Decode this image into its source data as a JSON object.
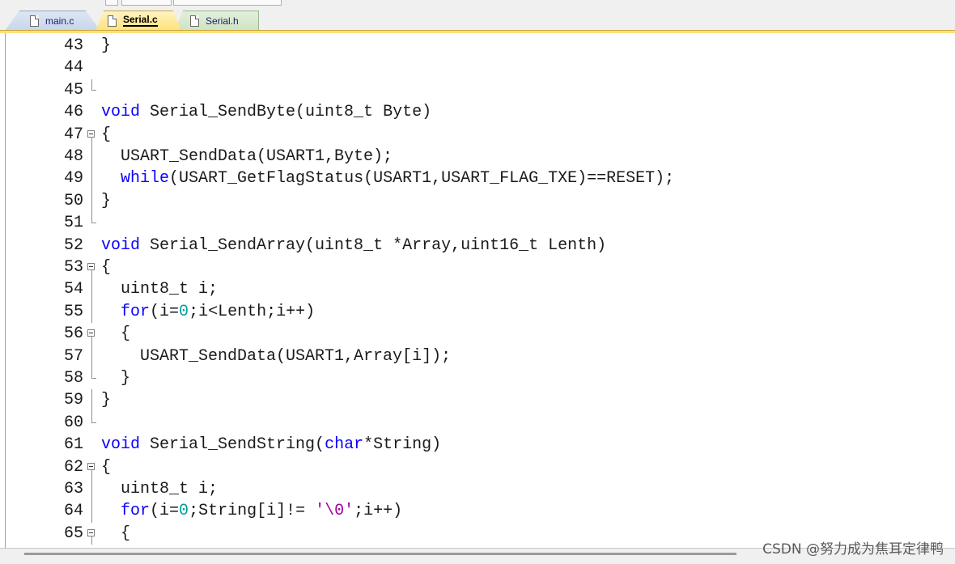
{
  "tabs": [
    {
      "label": "main.c",
      "active": false
    },
    {
      "label": "Serial.c",
      "active": true
    },
    {
      "label": "Serial.h",
      "active": false
    }
  ],
  "lines": [
    {
      "no": "43",
      "fold": "none",
      "code": "}"
    },
    {
      "no": "44",
      "fold": "none",
      "code": ""
    },
    {
      "no": "45",
      "fold": "end",
      "code": ""
    },
    {
      "no": "46",
      "fold": "none",
      "code": "void Serial_SendByte(uint8_t Byte)"
    },
    {
      "no": "47",
      "fold": "box",
      "code": "{"
    },
    {
      "no": "48",
      "fold": "bar",
      "code": "  USART_SendData(USART1,Byte);"
    },
    {
      "no": "49",
      "fold": "bar",
      "code": "  while(USART_GetFlagStatus(USART1,USART_FLAG_TXE)==RESET);"
    },
    {
      "no": "50",
      "fold": "bar",
      "code": "}"
    },
    {
      "no": "51",
      "fold": "end",
      "code": ""
    },
    {
      "no": "52",
      "fold": "none",
      "code": "void Serial_SendArray(uint8_t *Array,uint16_t Lenth)"
    },
    {
      "no": "53",
      "fold": "box",
      "code": "{"
    },
    {
      "no": "54",
      "fold": "bar",
      "code": "  uint8_t i;"
    },
    {
      "no": "55",
      "fold": "bar",
      "code": "  for(i=0;i<Lenth;i++)"
    },
    {
      "no": "56",
      "fold": "box",
      "code": "  {"
    },
    {
      "no": "57",
      "fold": "bar",
      "code": "    USART_SendData(USART1,Array[i]);"
    },
    {
      "no": "58",
      "fold": "end",
      "code": "  }"
    },
    {
      "no": "59",
      "fold": "bar",
      "code": "}"
    },
    {
      "no": "60",
      "fold": "end",
      "code": ""
    },
    {
      "no": "61",
      "fold": "none",
      "code": "void Serial_SendString(char*String)"
    },
    {
      "no": "62",
      "fold": "box",
      "code": "{"
    },
    {
      "no": "63",
      "fold": "bar",
      "code": "  uint8_t i;"
    },
    {
      "no": "64",
      "fold": "bar",
      "code": "  for(i=0;String[i]!= '\\0';i++)"
    },
    {
      "no": "65",
      "fold": "box",
      "code": "  {"
    }
  ],
  "watermark": "CSDN @努力成为焦耳定律鸭",
  "colors": {
    "keyword": "#0a00ff",
    "number": "#00a0a0",
    "string": "#a000a0",
    "active_tab": "#fde27c"
  }
}
